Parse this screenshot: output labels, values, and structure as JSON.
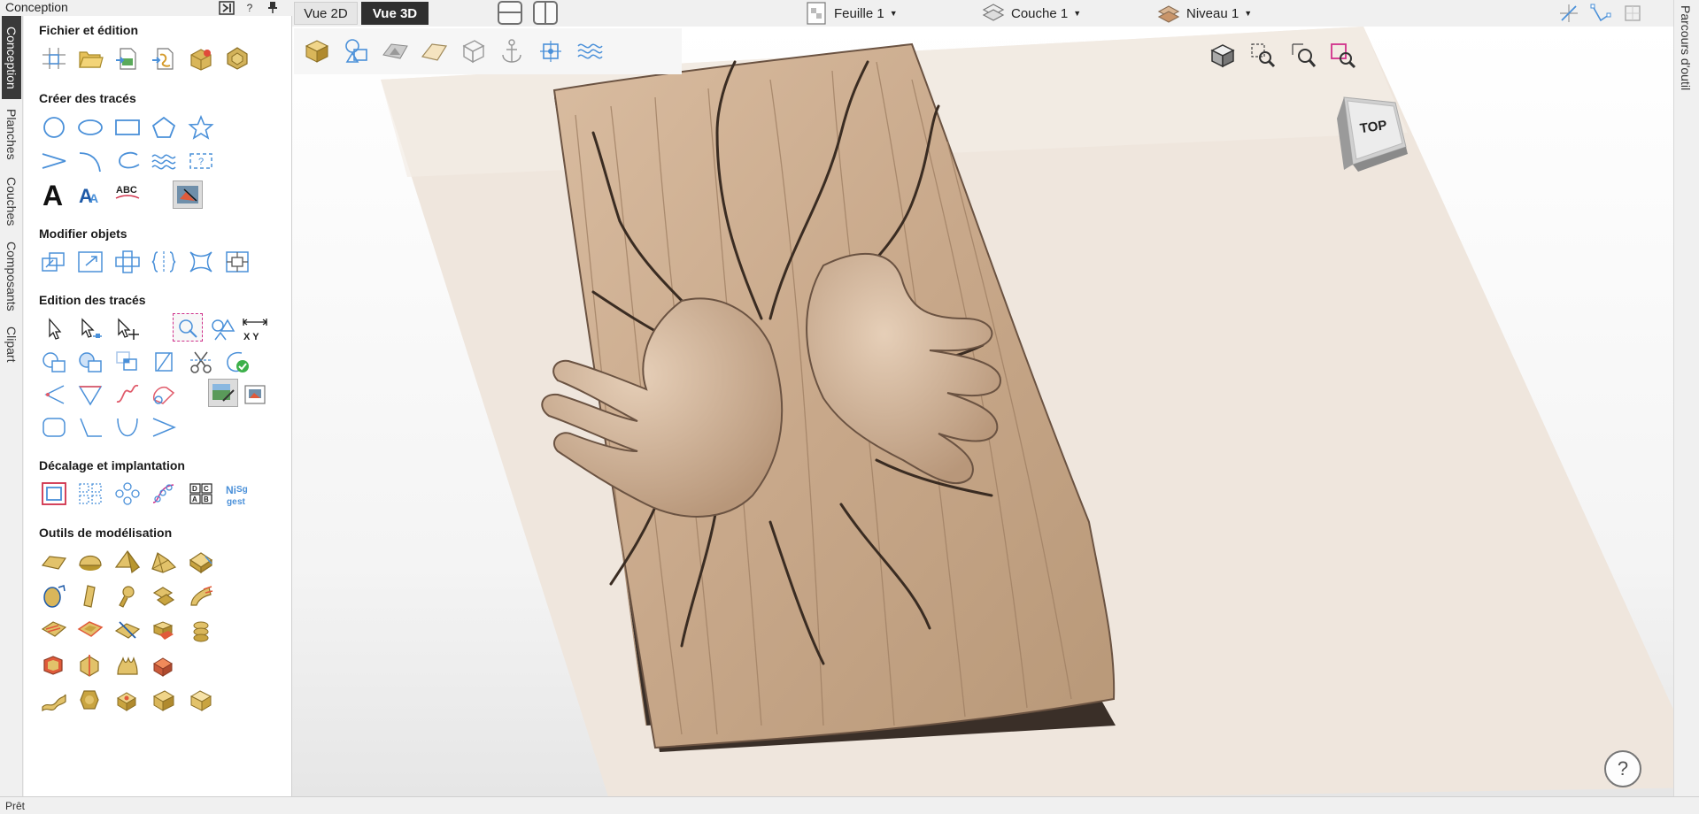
{
  "panel": {
    "title": "Conception",
    "sections": [
      {
        "title": "Fichier et édition"
      },
      {
        "title": "Créer des tracés"
      },
      {
        "title": "Modifier objets"
      },
      {
        "title": "Edition des tracés"
      },
      {
        "title": "Décalage et implantation"
      },
      {
        "title": "Outils de modélisation"
      }
    ]
  },
  "side_tabs": [
    "Conception",
    "Planches",
    "Couches",
    "Composants",
    "Clipart"
  ],
  "right_tab": "Parcours d'outil",
  "topbar": {
    "view_2d": "Vue 2D",
    "view_3d": "Vue 3D",
    "sheet": "Feuille 1",
    "layer": "Couche 1",
    "level": "Niveau 1"
  },
  "view_cube": {
    "face": "TOP"
  },
  "help_label": "?",
  "status": "Prêt",
  "colors": {
    "accent": "#4a90d9",
    "active_tab": "#3a3a3a",
    "wood_model": "#c9ab8e",
    "wood_plate": "#efe6dd",
    "gold_tool": "#d9b65a"
  },
  "icons": {
    "pin": "pin-icon",
    "help": "question-icon",
    "collapse": "collapse-panel-icon"
  }
}
